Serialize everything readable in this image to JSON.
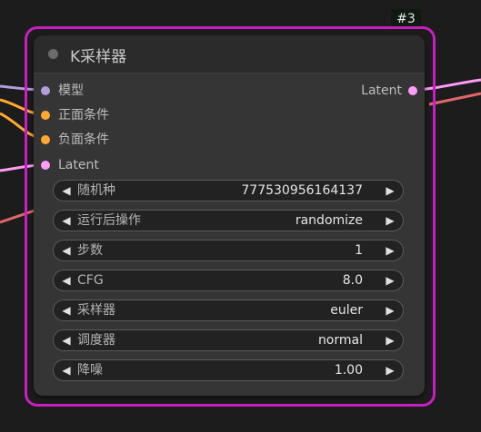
{
  "node": {
    "id_badge": "#3",
    "title": "K采样器",
    "inputs": [
      {
        "label": "模型",
        "color": "#b39ddb"
      },
      {
        "label": "正面条件",
        "color": "#ffa931"
      },
      {
        "label": "负面条件",
        "color": "#ffa931"
      },
      {
        "label": "Latent",
        "color": "#ff9cf9"
      }
    ],
    "output": {
      "label": "Latent",
      "color": "#ff9cf9"
    },
    "widgets": [
      {
        "name": "随机种",
        "value": "777530956164137"
      },
      {
        "name": "运行后操作",
        "value": "randomize"
      },
      {
        "name": "步数",
        "value": "1"
      },
      {
        "name": "CFG",
        "value": "8.0"
      },
      {
        "name": "采样器",
        "value": "euler"
      },
      {
        "name": "调度器",
        "value": "normal"
      },
      {
        "name": "降噪",
        "value": "1.00"
      }
    ],
    "arrow_left": "◀",
    "arrow_right": "▶"
  },
  "colors": {
    "selection_border": "#c81fc2",
    "node_body": "#353535",
    "title_bar": "#2b2b2b",
    "wire_purple": "#b39ddb",
    "wire_orange": "#ffa931",
    "wire_pink": "#ff9cf9",
    "wire_red": "#e06868"
  }
}
